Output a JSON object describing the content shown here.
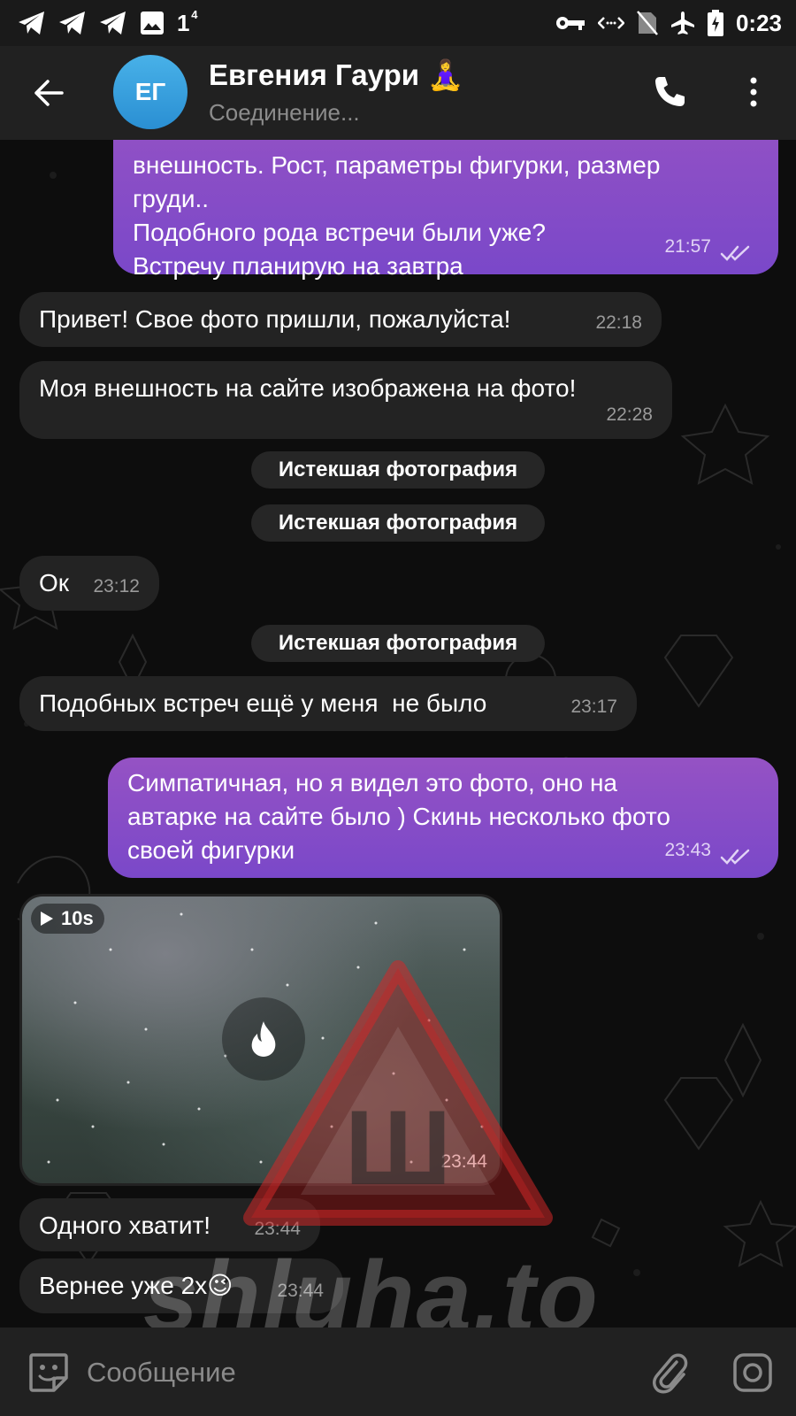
{
  "status_bar": {
    "notification_count": "1",
    "notification_sup": "4",
    "time": "0:23",
    "icons": [
      "telegram-icon",
      "telegram-icon",
      "telegram-icon",
      "image-icon",
      "key-icon",
      "data-saver-icon",
      "no-sim-icon",
      "airplane-icon",
      "battery-charging-icon"
    ]
  },
  "header": {
    "avatar_initials": "ЕГ",
    "contact_name": "Евгения Гаури 🧘‍♀️",
    "contact_status": "Соединение...",
    "avatar_color": "#3aa3e0"
  },
  "messages": [
    {
      "direction": "out",
      "text_lines": [
        "внешность. Рост, параметры фигурки, размер",
        "груди..",
        "Подобного рода встречи были уже?",
        "Встречу планирую на завтра"
      ],
      "time": "21:57",
      "read": true
    },
    {
      "direction": "in",
      "text": "Привет! Свое фото пришли, пожалуйста!",
      "time": "22:18"
    },
    {
      "direction": "in",
      "text": "Моя внешность на сайте изображена на фото!",
      "time": "22:28"
    },
    {
      "direction": "service",
      "text": "Истекшая фотография"
    },
    {
      "direction": "service",
      "text": "Истекшая фотография"
    },
    {
      "direction": "in",
      "text": "Ок",
      "time": "23:12"
    },
    {
      "direction": "service",
      "text": "Истекшая фотография"
    },
    {
      "direction": "in",
      "text": "Подобных встреч ещё у меня  не было",
      "time": "23:17"
    },
    {
      "direction": "out",
      "text_lines": [
        "Симпатичная, но я видел это фото, оно на",
        "автарке на сайте было ) Скинь несколько фото",
        "своей фигурки"
      ],
      "time": "23:43",
      "read": true
    },
    {
      "direction": "in",
      "type": "video",
      "duration": "10s",
      "time": "23:44"
    },
    {
      "direction": "in",
      "text": "Одного хватит!",
      "time": "23:44"
    },
    {
      "direction": "in",
      "text": "Вернее уже 2х😉",
      "time": "23:44"
    }
  ],
  "watermark": {
    "text": "shluha.to",
    "glyph": "Ш"
  },
  "composer": {
    "placeholder": "Сообщение"
  },
  "colors": {
    "outgoing_bubble": "#8a4fc6",
    "incoming_bubble": "#232323",
    "header": "#212121",
    "background": "#0d0d0d"
  }
}
